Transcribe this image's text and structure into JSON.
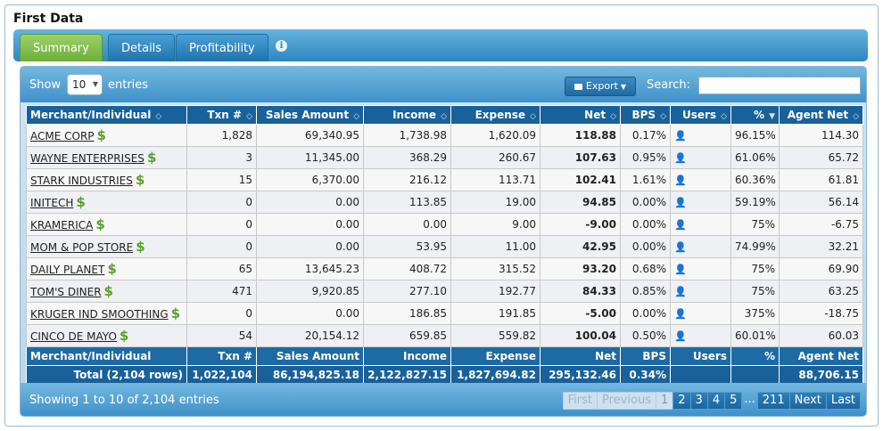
{
  "title": "First Data",
  "tabs": [
    {
      "label": "Summary",
      "active": true
    },
    {
      "label": "Details",
      "active": false
    },
    {
      "label": "Profitability",
      "active": false
    }
  ],
  "info_icon": "info-icon",
  "controls": {
    "show_label": "Show",
    "page_size": "10",
    "entries_label": "entries",
    "export_label": "Export",
    "search_label": "Search:",
    "search_value": ""
  },
  "columns": [
    "Merchant/Individual",
    "Txn #",
    "Sales Amount",
    "Income",
    "Expense",
    "Net",
    "BPS",
    "Users",
    "%",
    "Agent Net"
  ],
  "rows": [
    [
      "ACME CORP",
      "1,828",
      "69,340.95",
      "1,738.98",
      "1,620.09",
      "118.88",
      "0.17%",
      "",
      "96.15%",
      "114.30"
    ],
    [
      "WAYNE ENTERPRISES",
      "3",
      "11,345.00",
      "368.29",
      "260.67",
      "107.63",
      "0.95%",
      "",
      "61.06%",
      "65.72"
    ],
    [
      "STARK INDUSTRIES",
      "15",
      "6,370.00",
      "216.12",
      "113.71",
      "102.41",
      "1.61%",
      "",
      "60.36%",
      "61.81"
    ],
    [
      "INITECH",
      "0",
      "0.00",
      "113.85",
      "19.00",
      "94.85",
      "0.00%",
      "",
      "59.19%",
      "56.14"
    ],
    [
      "KRAMERICA",
      "0",
      "0.00",
      "0.00",
      "9.00",
      "-9.00",
      "0.00%",
      "",
      "75%",
      "-6.75"
    ],
    [
      "MOM & POP STORE",
      "0",
      "0.00",
      "53.95",
      "11.00",
      "42.95",
      "0.00%",
      "",
      "74.99%",
      "32.21"
    ],
    [
      "DAILY PLANET",
      "65",
      "13,645.23",
      "408.72",
      "315.52",
      "93.20",
      "0.68%",
      "",
      "75%",
      "69.90"
    ],
    [
      "TOM'S DINER",
      "471",
      "9,920.85",
      "277.10",
      "192.77",
      "84.33",
      "0.85%",
      "",
      "75%",
      "63.25"
    ],
    [
      "KRUGER IND SMOOTHING",
      "0",
      "0.00",
      "186.85",
      "191.85",
      "-5.00",
      "0.00%",
      "",
      "375%",
      "-18.75"
    ],
    [
      "CINCO DE MAYO",
      "54",
      "20,154.12",
      "659.85",
      "559.82",
      "100.04",
      "0.50%",
      "",
      "60.01%",
      "60.03"
    ]
  ],
  "totals": [
    "Total (2,104 rows)",
    "1,022,104",
    "86,194,825.18",
    "2,122,827.15",
    "1,827,694.82",
    "295,132.46",
    "0.34%",
    "",
    "",
    "88,706.15"
  ],
  "dollar_symbol": "$",
  "user_icon_glyph": "👤",
  "footer": {
    "info": "Showing 1 to 10 of 2,104 entries",
    "pager": [
      {
        "label": "First",
        "state": "disabled"
      },
      {
        "label": "Previous",
        "state": "disabled"
      },
      {
        "label": "1",
        "state": "current"
      },
      {
        "label": "2",
        "state": "normal"
      },
      {
        "label": "3",
        "state": "normal"
      },
      {
        "label": "4",
        "state": "normal"
      },
      {
        "label": "5",
        "state": "normal"
      },
      {
        "label": "...",
        "state": "ellipsis"
      },
      {
        "label": "211",
        "state": "normal"
      },
      {
        "label": "Next",
        "state": "normal"
      },
      {
        "label": "Last",
        "state": "normal"
      }
    ]
  },
  "colors": {
    "header_blue": "#19619a",
    "accent_green": "#6fae3a",
    "dollar_green": "#5aa02c"
  }
}
